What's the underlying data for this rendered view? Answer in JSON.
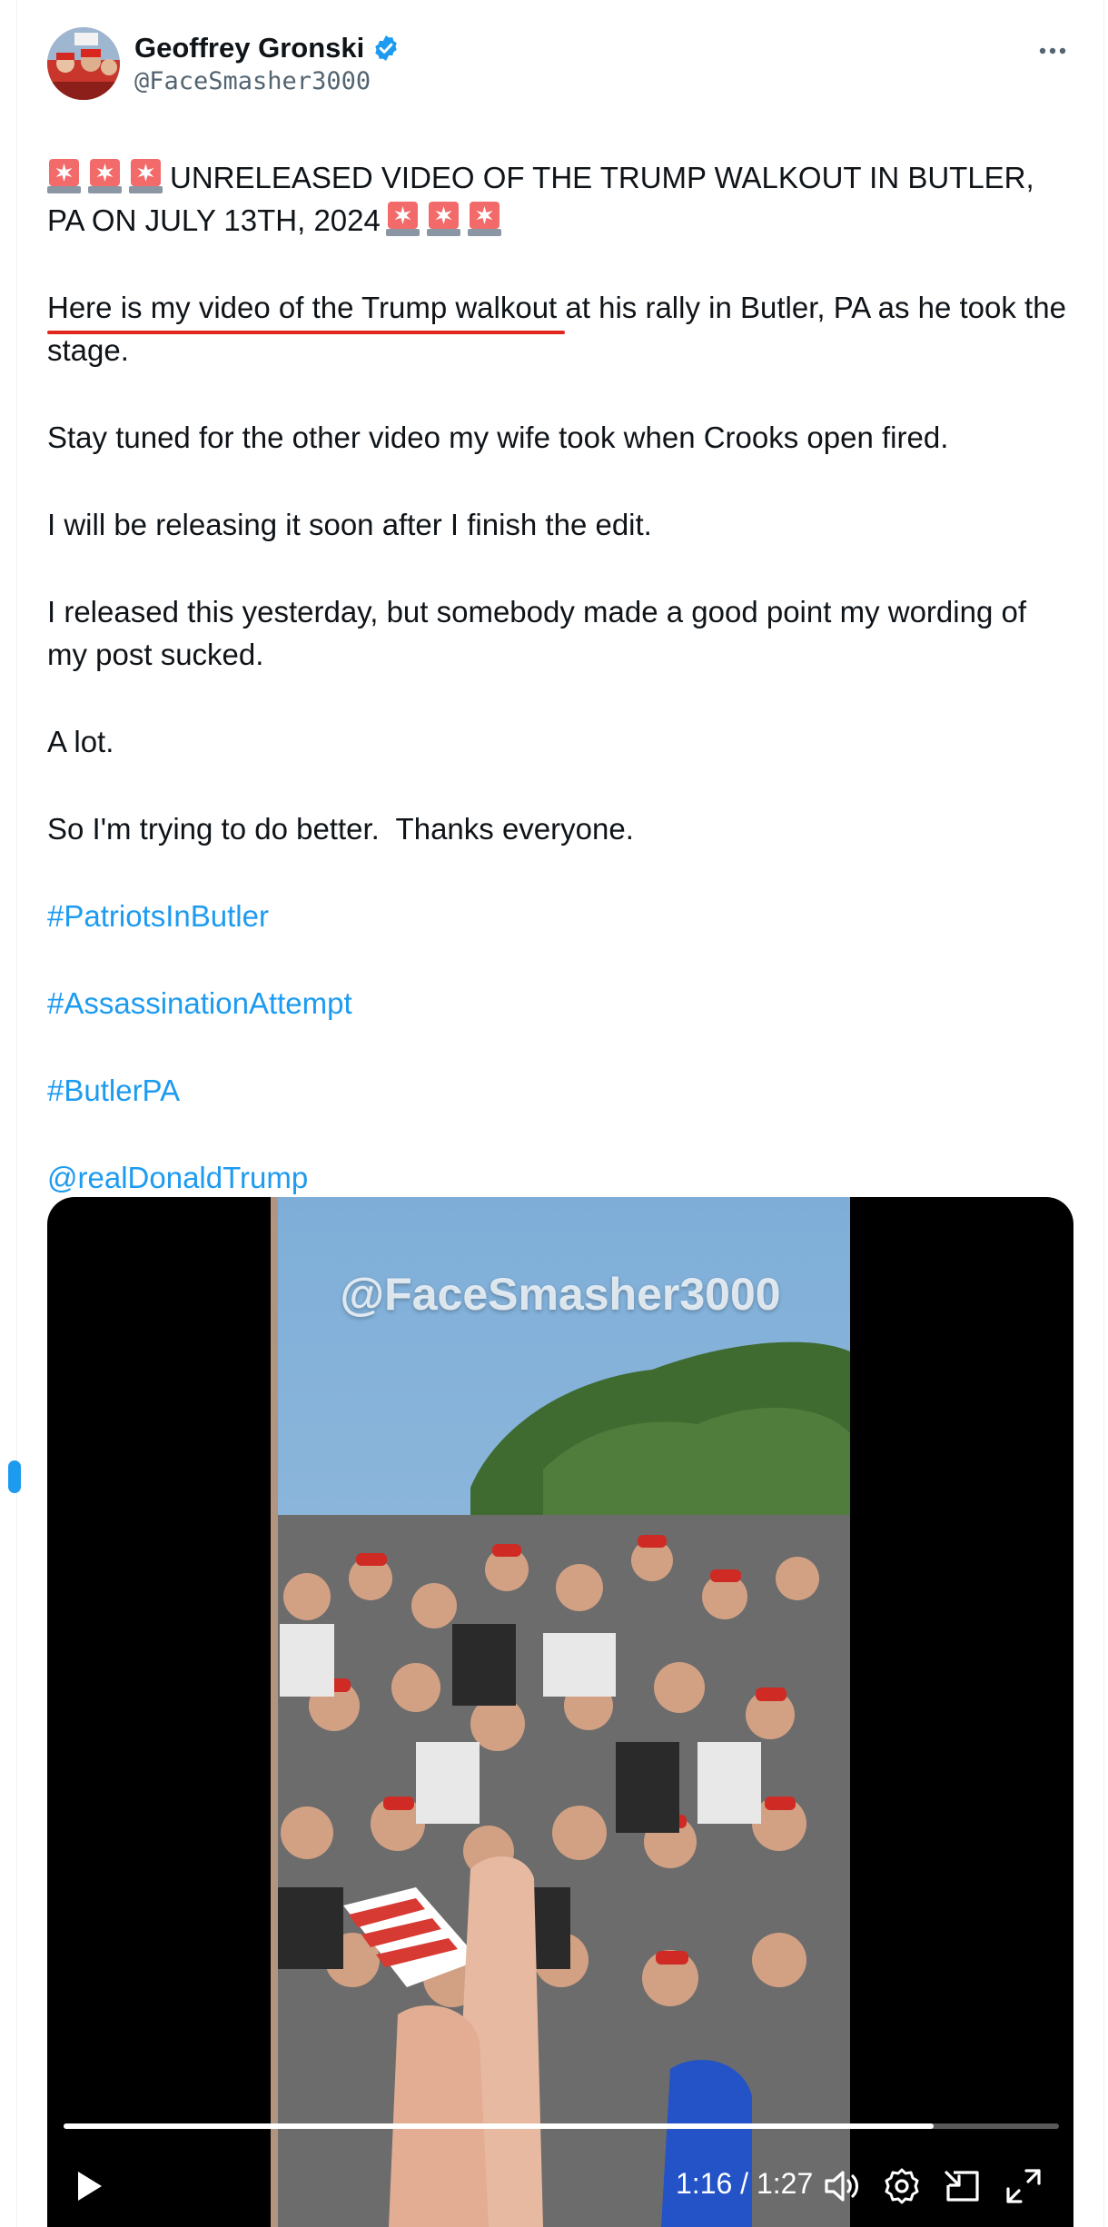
{
  "author": {
    "name": "Geoffrey Gronski",
    "handle": "@FaceSmasher3000",
    "verified": true
  },
  "icons": {
    "more": "more-options-icon",
    "verified": "verified-badge-icon",
    "siren": "siren-emoji"
  },
  "post": {
    "headline": "UNRELEASED VIDEO OF THE TRUMP WALKOUT IN BUTLER, PA ON JULY 13TH, 2024",
    "para1_underlined": "Here is my video of the Trump walkout ",
    "para1_rest": "at his rally in Butler, PA as he took the stage.",
    "para2": "Stay tuned for the other video my wife took when Crooks open fired.",
    "para3": "I will be releasing it soon after I finish the edit.",
    "para4": "I released this yesterday, but somebody made a good point my wording of my post sucked.",
    "para5": "A lot.",
    "para6": "So I'm trying to do better.  Thanks everyone.",
    "hashtags": [
      "#PatriotsInButler",
      "#AssassinationAttempt",
      "#ButlerPA"
    ],
    "mention": "@realDonaldTrump"
  },
  "video": {
    "watermark": "@FaceSmasher3000",
    "time": "1:16 / 1:27",
    "progress": 0.874
  },
  "colors": {
    "link": "#1d9bf0",
    "underline": "#e0261d",
    "text": "#0f1419",
    "muted": "#536471"
  }
}
